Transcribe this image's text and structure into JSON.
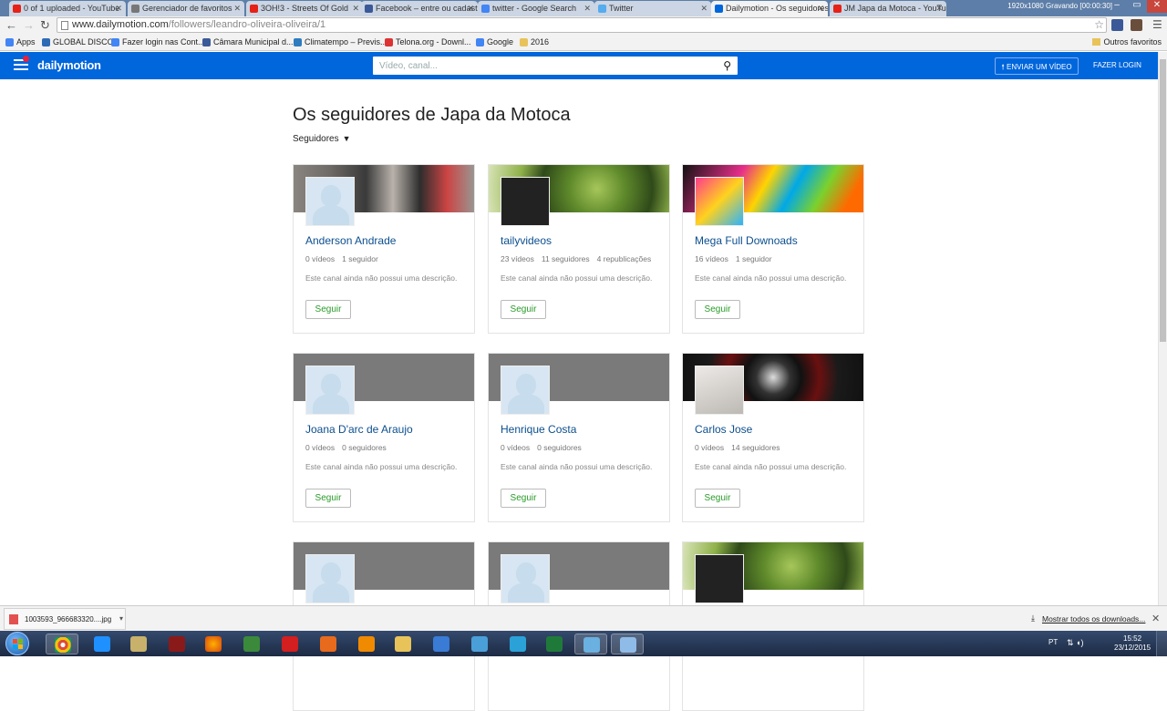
{
  "browser": {
    "tabs": [
      {
        "title": "0 of 1 uploaded - YouTube",
        "color": "#e62117"
      },
      {
        "title": "Gerenciador de favoritos",
        "color": "#777777"
      },
      {
        "title": "3OH!3 - Streets Of Gold",
        "color": "#e62117"
      },
      {
        "title": "Facebook – entre ou cadastre-se",
        "color": "#3b5998"
      },
      {
        "title": "twitter - Google Search",
        "color": "#4285f4"
      },
      {
        "title": "Twitter",
        "color": "#55acee"
      },
      {
        "title": "Dailymotion - Os seguidores",
        "color": "#0066dc"
      },
      {
        "title": "JM Japa da Motoca - YouTube",
        "color": "#e62117"
      }
    ],
    "recording": "1920x1080     Gravando [00:00:30]",
    "url_host": "www.dailymotion.com",
    "url_path": "/followers/leandro-oliveira-oliveira/1",
    "bookmarks": [
      {
        "label": "Apps",
        "color": "#4285f4"
      },
      {
        "label": "GLOBAL DISCO",
        "color": "#2d6bb5"
      },
      {
        "label": "Fazer login nas Cont...",
        "color": "#4285f4"
      },
      {
        "label": "Câmara Municipal d...",
        "color": "#3b5998"
      },
      {
        "label": "Climatempo – Previs...",
        "color": "#2e7cc0"
      },
      {
        "label": "Telona.org - Downl...",
        "color": "#d33"
      },
      {
        "label": "Google",
        "color": "#4285f4"
      },
      {
        "label": "2016",
        "color": "#e8c35a"
      }
    ],
    "other_bookmarks": "Outros favoritos"
  },
  "header": {
    "logo": "dailymotion",
    "search_placeholder": "Vídeo, canal...",
    "upload_label": "ENVIAR UM VÍDEO",
    "login_label": "FAZER LOGIN",
    "brand_color": "#0066dc"
  },
  "main": {
    "title": "Os seguidores de Japa da Motoca",
    "filter_label": "Seguidores",
    "cards": [
      {
        "name": "Anderson Andrade",
        "stats": [
          "0 vídeos",
          "1 seguidor"
        ],
        "desc": "Este canal ainda não possui uma descrição.",
        "follow": "Seguir",
        "cover": "photo-people",
        "avatar": "default"
      },
      {
        "name": "tailyvideos",
        "stats": [
          "23 vídeos",
          "11 seguidores",
          "4 republicações"
        ],
        "desc": "Este canal ainda não possui uma descrição.",
        "follow": "Seguir",
        "cover": "photo-leaves",
        "avatar": "logo"
      },
      {
        "name": "Mega Full Downoads",
        "stats": [
          "16 vídeos",
          "1 seguidor"
        ],
        "desc": "Este canal ainda não possui uma descrição.",
        "follow": "Seguir",
        "cover": "colorful-cubes",
        "avatar": "cubes"
      },
      {
        "name": "Joana D'arc de Araujo",
        "stats": [
          "0 vídeos",
          "0 seguidores"
        ],
        "desc": "Este canal ainda não possui uma descrição.",
        "follow": "Seguir",
        "cover": "gray",
        "avatar": "default"
      },
      {
        "name": "Henrique Costa",
        "stats": [
          "0 vídeos",
          "0 seguidores"
        ],
        "desc": "Este canal ainda não possui uma descrição.",
        "follow": "Seguir",
        "cover": "gray",
        "avatar": "default"
      },
      {
        "name": "Carlos Jose",
        "stats": [
          "0 vídeos",
          "14 seguidores"
        ],
        "desc": "Este canal ainda não possui uma descrição.",
        "follow": "Seguir",
        "cover": "dark-emblem",
        "avatar": "photo"
      },
      {
        "name": "",
        "stats": [],
        "desc": "",
        "follow": "",
        "cover": "gray",
        "avatar": "default"
      },
      {
        "name": "",
        "stats": [],
        "desc": "",
        "follow": "",
        "cover": "gray",
        "avatar": "default"
      },
      {
        "name": "",
        "stats": [],
        "desc": "",
        "follow": "",
        "cover": "photo-leaves",
        "avatar": "logo"
      }
    ]
  },
  "downloads": {
    "file": "1003593_966683320....jpg",
    "show_all": "Mostrar todos os downloads..."
  },
  "taskbar": {
    "lang": "PT",
    "time": "15:52",
    "date": "23/12/2015"
  }
}
